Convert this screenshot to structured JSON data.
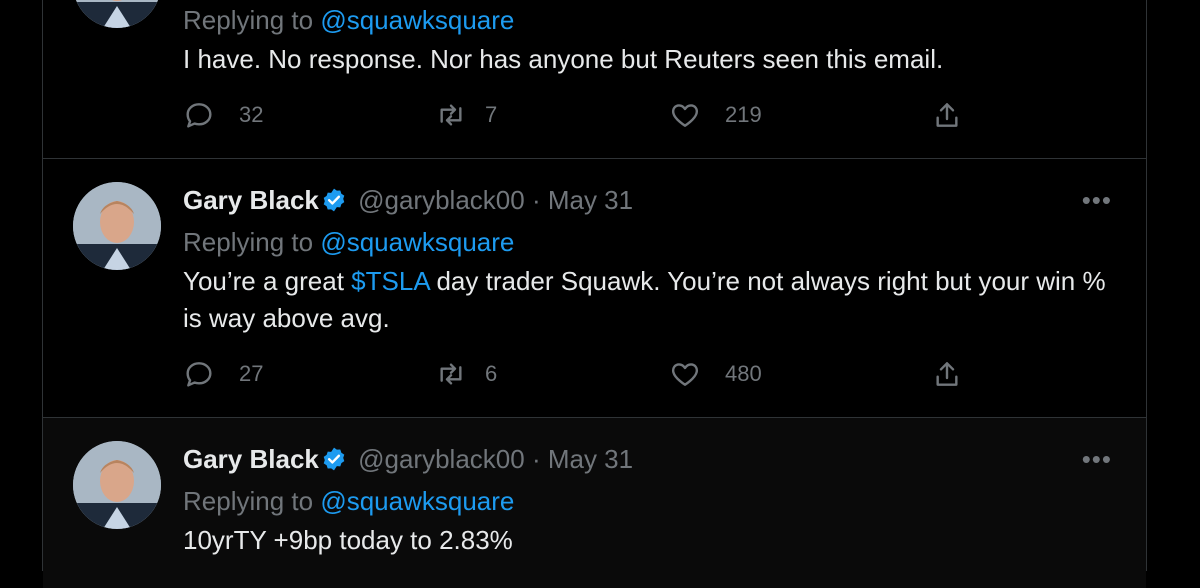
{
  "tweets": [
    {
      "replying_prefix": "Replying to",
      "replying_handle": "@squawksquare",
      "text": "I have. No response. Nor has anyone but Reuters seen this email.",
      "replies": "32",
      "retweets": "7",
      "likes": "219"
    },
    {
      "name": "Gary Black",
      "handle": "@garyblack00",
      "sep": "·",
      "date": "May 31",
      "more": "•••",
      "replying_prefix": "Replying to",
      "replying_handle": "@squawksquare",
      "text_before": "You’re a great ",
      "cashtag": "$TSLA",
      "text_after": " day trader Squawk.  You’re not always right but your win % is way above avg.",
      "replies": "27",
      "retweets": "6",
      "likes": "480"
    },
    {
      "name": "Gary Black",
      "handle": "@garyblack00",
      "sep": "·",
      "date": "May 31",
      "more": "•••",
      "replying_prefix": "Replying to",
      "replying_handle": "@squawksquare",
      "text": "10yrTY +9bp today to 2.83%"
    }
  ],
  "colors": {
    "link": "#1d9bf0",
    "muted": "#71767b",
    "background": "#000000",
    "verified": "#1d9bf0"
  },
  "icons": [
    "reply-icon",
    "retweet-icon",
    "like-icon",
    "share-icon",
    "verified-badge-icon",
    "more-icon"
  ]
}
